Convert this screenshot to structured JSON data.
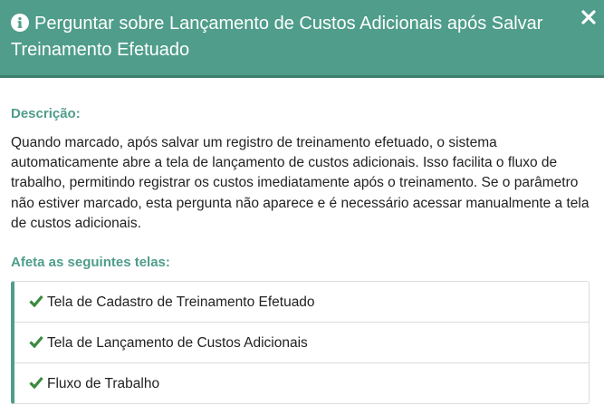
{
  "dialog": {
    "title": "Perguntar sobre Lançamento de Custos Adicionais após Salvar Treinamento Efetuado",
    "close_label": "×",
    "accent_color": "#4f9d8a"
  },
  "description": {
    "label": "Descrição:",
    "text": "Quando marcado, após salvar um registro de treinamento efetuado, o sistema automaticamente abre a tela de lançamento de custos adicionais. Isso facilita o fluxo de trabalho, permitindo registrar os custos imediatamente após o treinamento. Se o parâmetro não estiver marcado, esta pergunta não aparece e é necessário acessar manualmente a tela de custos adicionais."
  },
  "affected_screens": {
    "label": "Afeta as seguintes telas:",
    "items": [
      "Tela de Cadastro de Treinamento Efetuado",
      "Tela de Lançamento de Custos Adicionais",
      "Fluxo de Trabalho"
    ]
  }
}
